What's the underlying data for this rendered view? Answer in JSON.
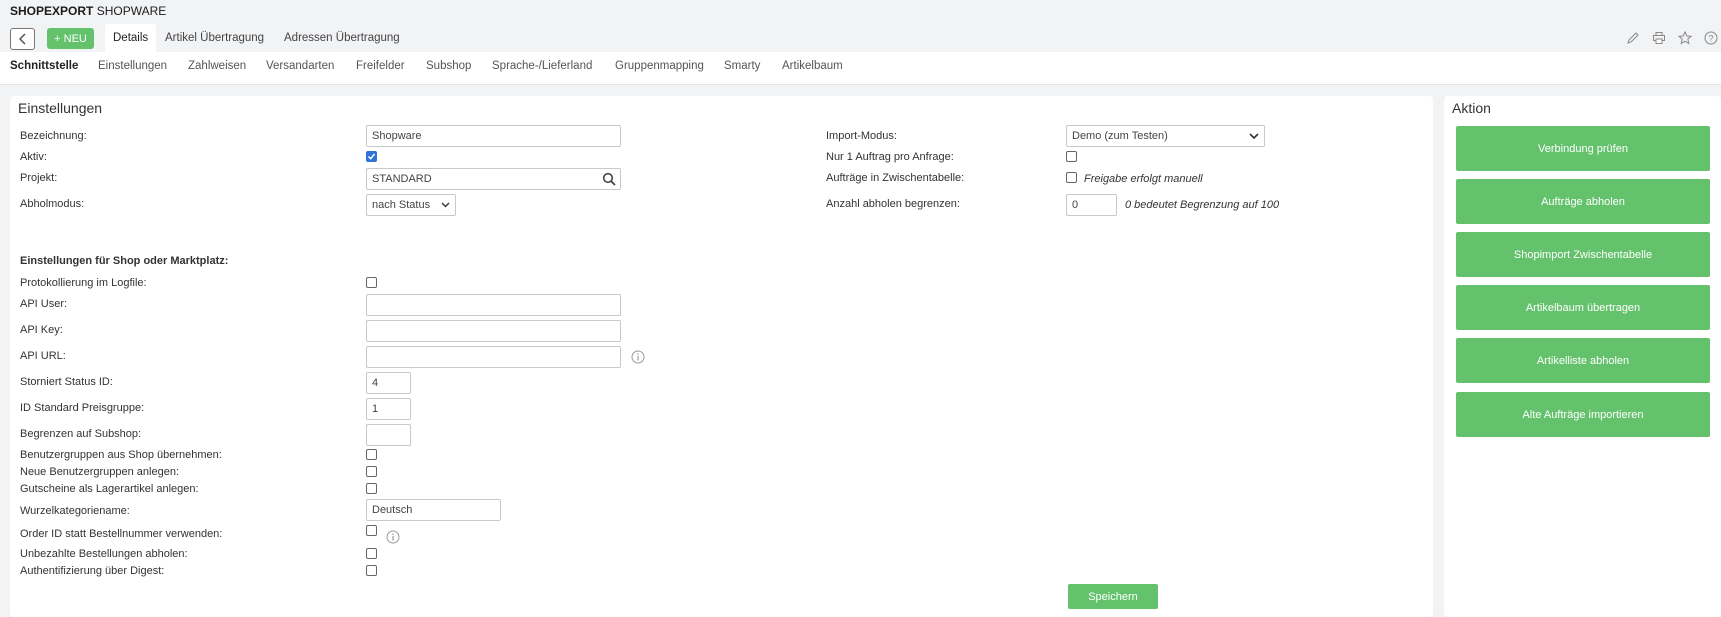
{
  "app": {
    "title_bold": "SHOPEXPORT",
    "title_rest": "SHOPWARE"
  },
  "toolbar": {
    "new_label": "+ NEU",
    "tabs": [
      "Details",
      "Artikel Übertragung",
      "Adressen Übertragung"
    ],
    "icons": [
      "pencil-icon",
      "printer-icon",
      "star-icon",
      "help-icon"
    ]
  },
  "subnav": [
    "Schnittstelle",
    "Einstellungen",
    "Zahlweisen",
    "Versandarten",
    "Freifelder",
    "Subshop",
    "Sprache-/Lieferland",
    "Gruppenmapping",
    "Smarty",
    "Artikelbaum"
  ],
  "settings": {
    "title": "Einstellungen",
    "bezeichnung": {
      "label": "Bezeichnung:",
      "value": "Shopware"
    },
    "aktiv": {
      "label": "Aktiv:",
      "checked": true
    },
    "projekt": {
      "label": "Projekt:",
      "value": "STANDARD"
    },
    "abholmodus": {
      "label": "Abholmodus:",
      "value": "nach Status"
    },
    "import_modus": {
      "label": "Import-Modus:",
      "value": "Demo (zum Testen)"
    },
    "nur1": {
      "label": "Nur 1 Auftrag pro Anfrage:",
      "checked": false
    },
    "zwischentabelle": {
      "label": "Aufträge in Zwischentabelle:",
      "checked": false,
      "hint": "Freigabe erfolgt manuell"
    },
    "anzahl": {
      "label": "Anzahl abholen begrenzen:",
      "value": "0",
      "hint": "0 bedeutet Begrenzung auf 100"
    },
    "shop_section_title": "Einstellungen für Shop oder Marktplatz:",
    "protokoll": {
      "label": "Protokollierung im Logfile:",
      "checked": false
    },
    "api_user": {
      "label": "API User:",
      "value": ""
    },
    "api_key": {
      "label": "API Key:",
      "value": ""
    },
    "api_url": {
      "label": "API URL:",
      "value": ""
    },
    "storniert": {
      "label": "Storniert Status ID:",
      "value": "4"
    },
    "preisgruppe": {
      "label": "ID Standard Preisgruppe:",
      "value": "1"
    },
    "subshop": {
      "label": "Begrenzen auf Subshop:",
      "value": ""
    },
    "benutzergruppen": {
      "label": "Benutzergruppen aus Shop übernehmen:",
      "checked": false
    },
    "neue_gruppen": {
      "label": "Neue Benutzergruppen anlegen:",
      "checked": false
    },
    "gutscheine": {
      "label": "Gutscheine als Lagerartikel anlegen:",
      "checked": false
    },
    "wurzel": {
      "label": "Wurzelkategoriename:",
      "value": "Deutsch"
    },
    "order_id": {
      "label": "Order ID statt Bestellnummer verwenden:",
      "checked": false
    },
    "unbezahlt": {
      "label": "Unbezahlte Bestellungen abholen:",
      "checked": false
    },
    "digest": {
      "label": "Authentifizierung über Digest:",
      "checked": false
    },
    "save_label": "Speichern"
  },
  "actions": {
    "title": "Aktion",
    "buttons": [
      "Verbindung prüfen",
      "Aufträge abholen",
      "Shopimport Zwischentabelle",
      "Artikelbaum übertragen",
      "Artikelliste abholen",
      "Alte Aufträge importieren"
    ]
  },
  "colors": {
    "accent": "#64c26d",
    "check": "#2f73d9",
    "background": "#f2f3f5"
  }
}
